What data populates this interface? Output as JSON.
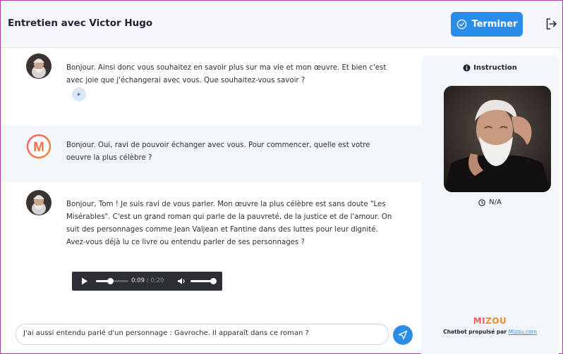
{
  "header": {
    "title": "Entretien avec Victor Hugo",
    "finish_label": "Terminer"
  },
  "messages": [
    {
      "sender": "Victor Hugo",
      "text": "Bonjour. Ainsi donc vous souhaitez en savoir plus sur ma vie et mon œuvre. Et bien c'est avec joie que j'échangerai avec vous. Que souhaitez-vous savoir ?"
    },
    {
      "sender": "user",
      "avatar_letter": "M",
      "text": "Bonjour. Oui, ravi de pouvoir échanger avec vous. Pour commencer, quelle est votre oeuvre la plus célèbre ?"
    },
    {
      "sender": "Victor Hugo",
      "text": "Bonjour, Tom ! Je suis ravi de vous parler. Mon œuvre la plus célèbre est sans doute \"Les Misérables\". C'est un grand roman qui parle de la pauvreté, de la justice et de l'amour. On suit des personnages comme Jean Valjean et Fantine dans des luttes pour leur dignité. Avez-vous déjà lu ce livre ou entendu parler de ses personnages ?"
    }
  ],
  "audio": {
    "current_time": "0:09",
    "separator": " / ",
    "duration": "0:20",
    "progress": 0.45,
    "volume": 1.0
  },
  "composer": {
    "value": "J'ai aussi entendu parlé d'un personnage : Gavroche. Il apparaît dans ce roman ?"
  },
  "sidebar": {
    "instruction_label": "Instruction",
    "timer_value": "N/A",
    "brand_mi": "MI",
    "brand_zou": "ZOU",
    "powered_prefix": "Chatbot propulsé par ",
    "powered_link": "Mizou.com"
  },
  "colors": {
    "accent": "#2c8de8",
    "frame": "#a640a8",
    "brand_red": "#ff5a5f",
    "brand_orange": "#f28b30"
  },
  "icons": [
    "check-circle-icon",
    "logout-icon",
    "play-icon",
    "volume-icon",
    "send-icon",
    "info-icon",
    "clock-icon"
  ]
}
